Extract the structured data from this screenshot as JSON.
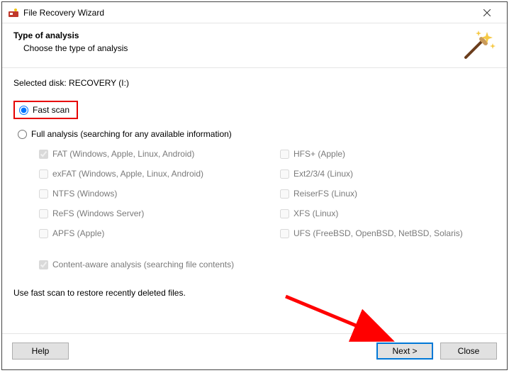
{
  "window": {
    "title": "File Recovery Wizard"
  },
  "header": {
    "title": "Type of analysis",
    "subtitle": "Choose the type of analysis"
  },
  "selected_disk_label": "Selected disk: RECOVERY (I:)",
  "options": {
    "fast_scan": "Fast scan",
    "full_analysis": "Full analysis (searching for any available information)"
  },
  "filesystems": {
    "left": [
      "FAT (Windows, Apple, Linux, Android)",
      "exFAT (Windows, Apple, Linux, Android)",
      "NTFS (Windows)",
      "ReFS (Windows Server)",
      "APFS (Apple)"
    ],
    "right": [
      "HFS+ (Apple)",
      "Ext2/3/4 (Linux)",
      "ReiserFS (Linux)",
      "XFS (Linux)",
      "UFS (FreeBSD, OpenBSD, NetBSD, Solaris)"
    ]
  },
  "content_aware_label": "Content-aware analysis (searching file contents)",
  "hint": "Use fast scan to restore recently deleted files.",
  "buttons": {
    "help": "Help",
    "next": "Next >",
    "close": "Close"
  },
  "colors": {
    "highlight_border": "#e60000",
    "primary_button_border": "#0078d7",
    "arrow": "#ff0000"
  }
}
